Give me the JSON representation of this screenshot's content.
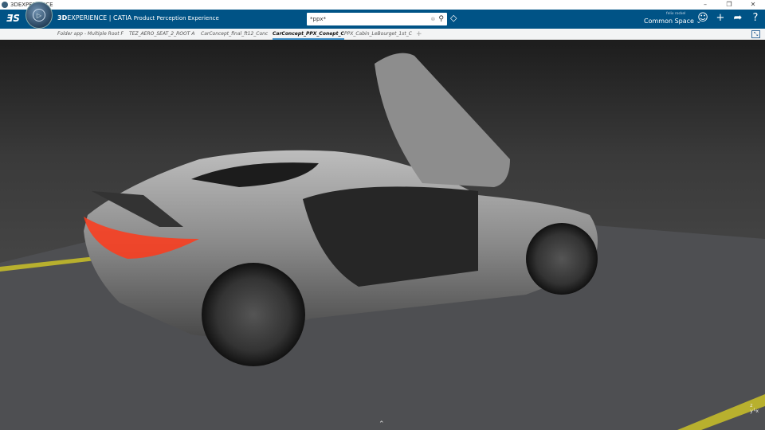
{
  "window": {
    "title": "3DEXPERIENCE",
    "controls": [
      "–",
      "❐",
      "✕"
    ]
  },
  "header": {
    "brand_bold": "3D",
    "brand_rest": "EXPERIENCE | CATIA",
    "app_name": "Product Perception Experience",
    "search": {
      "value": "*ppx*"
    },
    "user": "felix rockel",
    "space": "Common Space ⌄"
  },
  "tabs": [
    {
      "label": "Folder app - Multiple Root F"
    },
    {
      "label": "TEZ_AERO_SEAT_2_ROOT A"
    },
    {
      "label": "CarConcept_final_ft12_Conc"
    },
    {
      "label": "CarConcept_PPX_Conept_C",
      "active": true
    },
    {
      "label": "PPX_Cabin_LeBourget_1st_C"
    }
  ],
  "viewport": {
    "axis_labels": {
      "x": "x",
      "y": "y",
      "z": "z"
    }
  },
  "colors": {
    "header": "#005386",
    "accent": "#3a8ec8",
    "floor_line": "#b8b02e",
    "taillight": "#ff3a1a"
  }
}
